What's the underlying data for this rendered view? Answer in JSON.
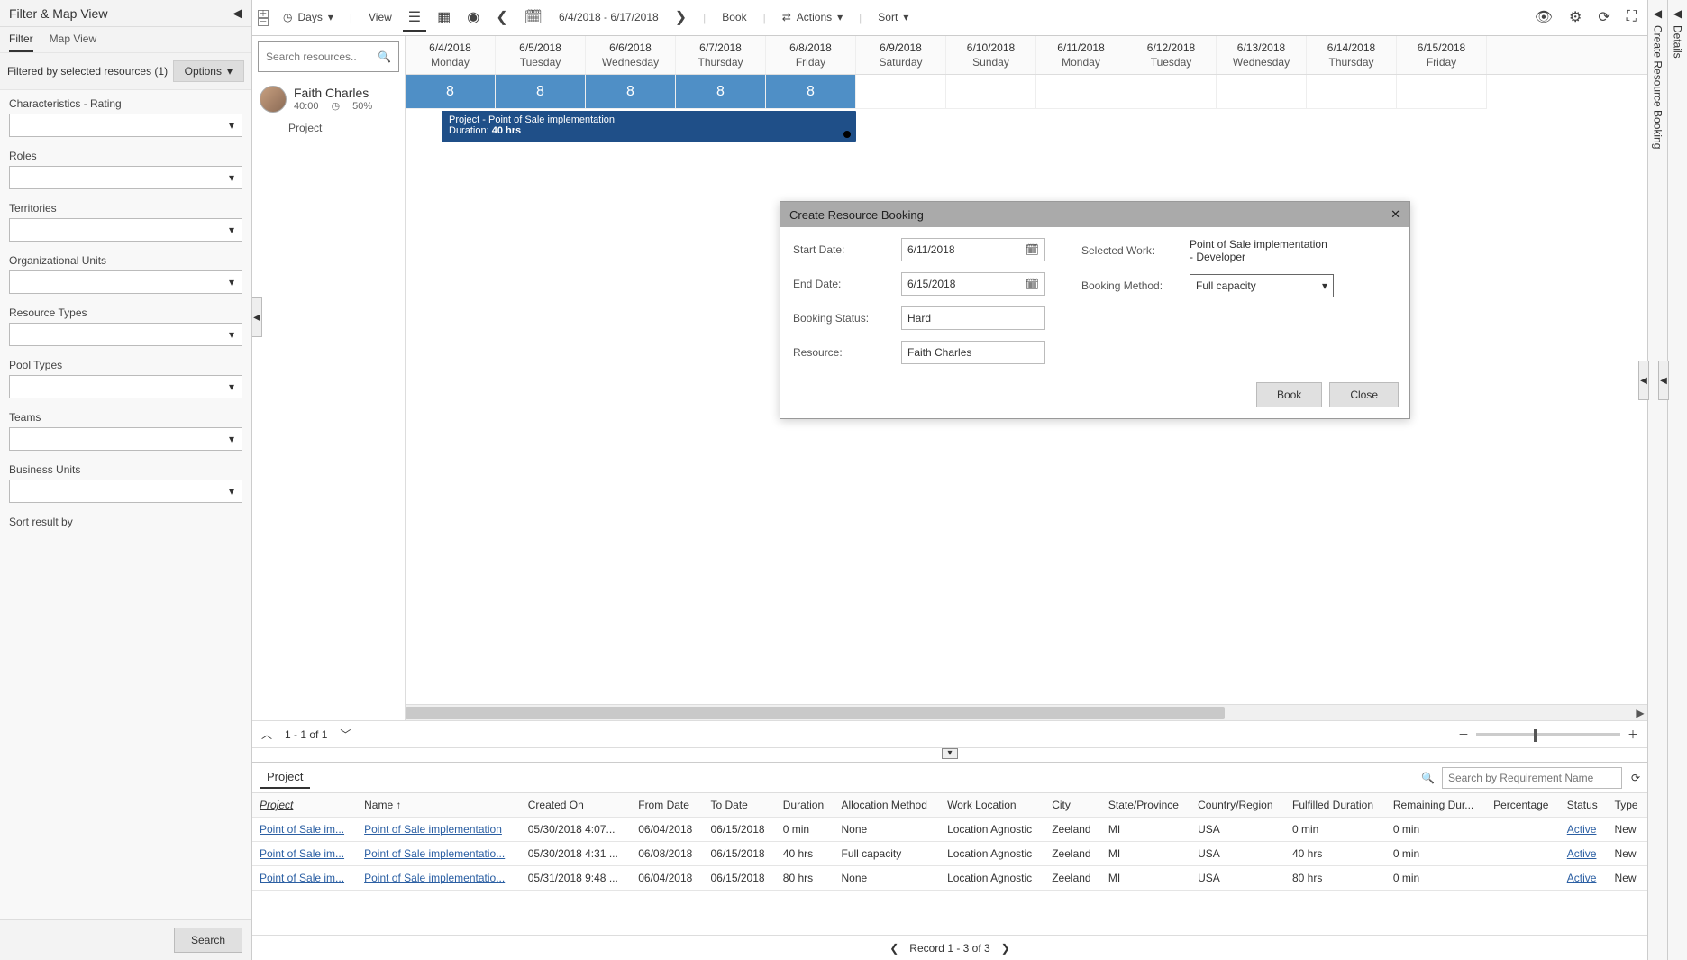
{
  "left": {
    "title": "Filter & Map View",
    "tabs": {
      "filter": "Filter",
      "map": "Map View"
    },
    "filtered_by": "Filtered by selected resources (1)",
    "options": "Options",
    "fields": {
      "char": "Characteristics - Rating",
      "roles": "Roles",
      "terr": "Territories",
      "org": "Organizational Units",
      "res": "Resource Types",
      "pool": "Pool Types",
      "teams": "Teams",
      "bu": "Business Units",
      "sort": "Sort result by"
    },
    "search_btn": "Search"
  },
  "toolbar": {
    "days": "Days",
    "view": "View",
    "date_range": "6/4/2018 - 6/17/2018",
    "book": "Book",
    "actions": "Actions",
    "sort": "Sort"
  },
  "search_res_ph": "Search resources...",
  "resource": {
    "name": "Faith Charles",
    "hours": "40:00",
    "pct": "50%",
    "sub": "Project"
  },
  "days": [
    {
      "date": "6/4/2018",
      "dow": "Monday",
      "cap": "8",
      "blue": true
    },
    {
      "date": "6/5/2018",
      "dow": "Tuesday",
      "cap": "8",
      "blue": true
    },
    {
      "date": "6/6/2018",
      "dow": "Wednesday",
      "cap": "8",
      "blue": true
    },
    {
      "date": "6/7/2018",
      "dow": "Thursday",
      "cap": "8",
      "blue": true
    },
    {
      "date": "6/8/2018",
      "dow": "Friday",
      "cap": "8",
      "blue": true
    },
    {
      "date": "6/9/2018",
      "dow": "Saturday",
      "cap": "",
      "blue": false
    },
    {
      "date": "6/10/2018",
      "dow": "Sunday",
      "cap": "",
      "blue": false
    },
    {
      "date": "6/11/2018",
      "dow": "Monday",
      "cap": "",
      "blue": false
    },
    {
      "date": "6/12/2018",
      "dow": "Tuesday",
      "cap": "",
      "blue": false
    },
    {
      "date": "6/13/2018",
      "dow": "Wednesday",
      "cap": "",
      "blue": false
    },
    {
      "date": "6/14/2018",
      "dow": "Thursday",
      "cap": "",
      "blue": false
    },
    {
      "date": "6/15/2018",
      "dow": "Friday",
      "cap": "",
      "blue": false
    }
  ],
  "task": {
    "line1": "Project - Point of Sale implementation",
    "line2_a": "Duration: ",
    "line2_b": "40 hrs"
  },
  "pager1": "1 - 1 of 1",
  "dialog": {
    "title": "Create Resource Booking",
    "start": "Start Date:",
    "start_v": "6/11/2018",
    "end": "End Date:",
    "end_v": "6/15/2018",
    "status": "Booking Status:",
    "status_v": "Hard",
    "resource": "Resource:",
    "resource_v": "Faith Charles",
    "work": "Selected Work:",
    "work_v": "Point of Sale implementation - Developer",
    "method": "Booking Method:",
    "method_v": "Full capacity",
    "book": "Book",
    "close": "Close"
  },
  "right": {
    "details": "Details",
    "create": "Create Resource Booking"
  },
  "bottom": {
    "tab": "Project",
    "search_ph": "Search by Requirement Name",
    "cols": [
      "Project",
      "Name",
      "Created On",
      "From Date",
      "To Date",
      "Duration",
      "Allocation Method",
      "Work Location",
      "City",
      "State/Province",
      "Country/Region",
      "Fulfilled Duration",
      "Remaining Dur...",
      "Percentage",
      "Status",
      "Type"
    ],
    "rows": [
      {
        "proj": "Point of Sale im...",
        "name": "Point of Sale implementation",
        "created": "05/30/2018 4:07...",
        "from": "06/04/2018",
        "to": "06/15/2018",
        "dur": "0 min",
        "alloc": "None",
        "wl": "Location Agnostic",
        "city": "Zeeland",
        "st": "MI",
        "ctry": "USA",
        "ful": "0 min",
        "rem": "0 min",
        "pct": "",
        "status": "Active",
        "type": "New"
      },
      {
        "proj": "Point of Sale im...",
        "name": "Point of Sale implementatio...",
        "created": "05/30/2018 4:31 ...",
        "from": "06/08/2018",
        "to": "06/15/2018",
        "dur": "40 hrs",
        "alloc": "Full capacity",
        "wl": "Location Agnostic",
        "city": "Zeeland",
        "st": "MI",
        "ctry": "USA",
        "ful": "40 hrs",
        "rem": "0 min",
        "pct": "",
        "status": "Active",
        "type": "New"
      },
      {
        "proj": "Point of Sale im...",
        "name": "Point of Sale implementatio...",
        "created": "05/31/2018 9:48 ...",
        "from": "06/04/2018",
        "to": "06/15/2018",
        "dur": "80 hrs",
        "alloc": "None",
        "wl": "Location Agnostic",
        "city": "Zeeland",
        "st": "MI",
        "ctry": "USA",
        "ful": "80 hrs",
        "rem": "0 min",
        "pct": "",
        "status": "Active",
        "type": "New"
      }
    ],
    "pager": "Record 1 - 3 of 3"
  }
}
